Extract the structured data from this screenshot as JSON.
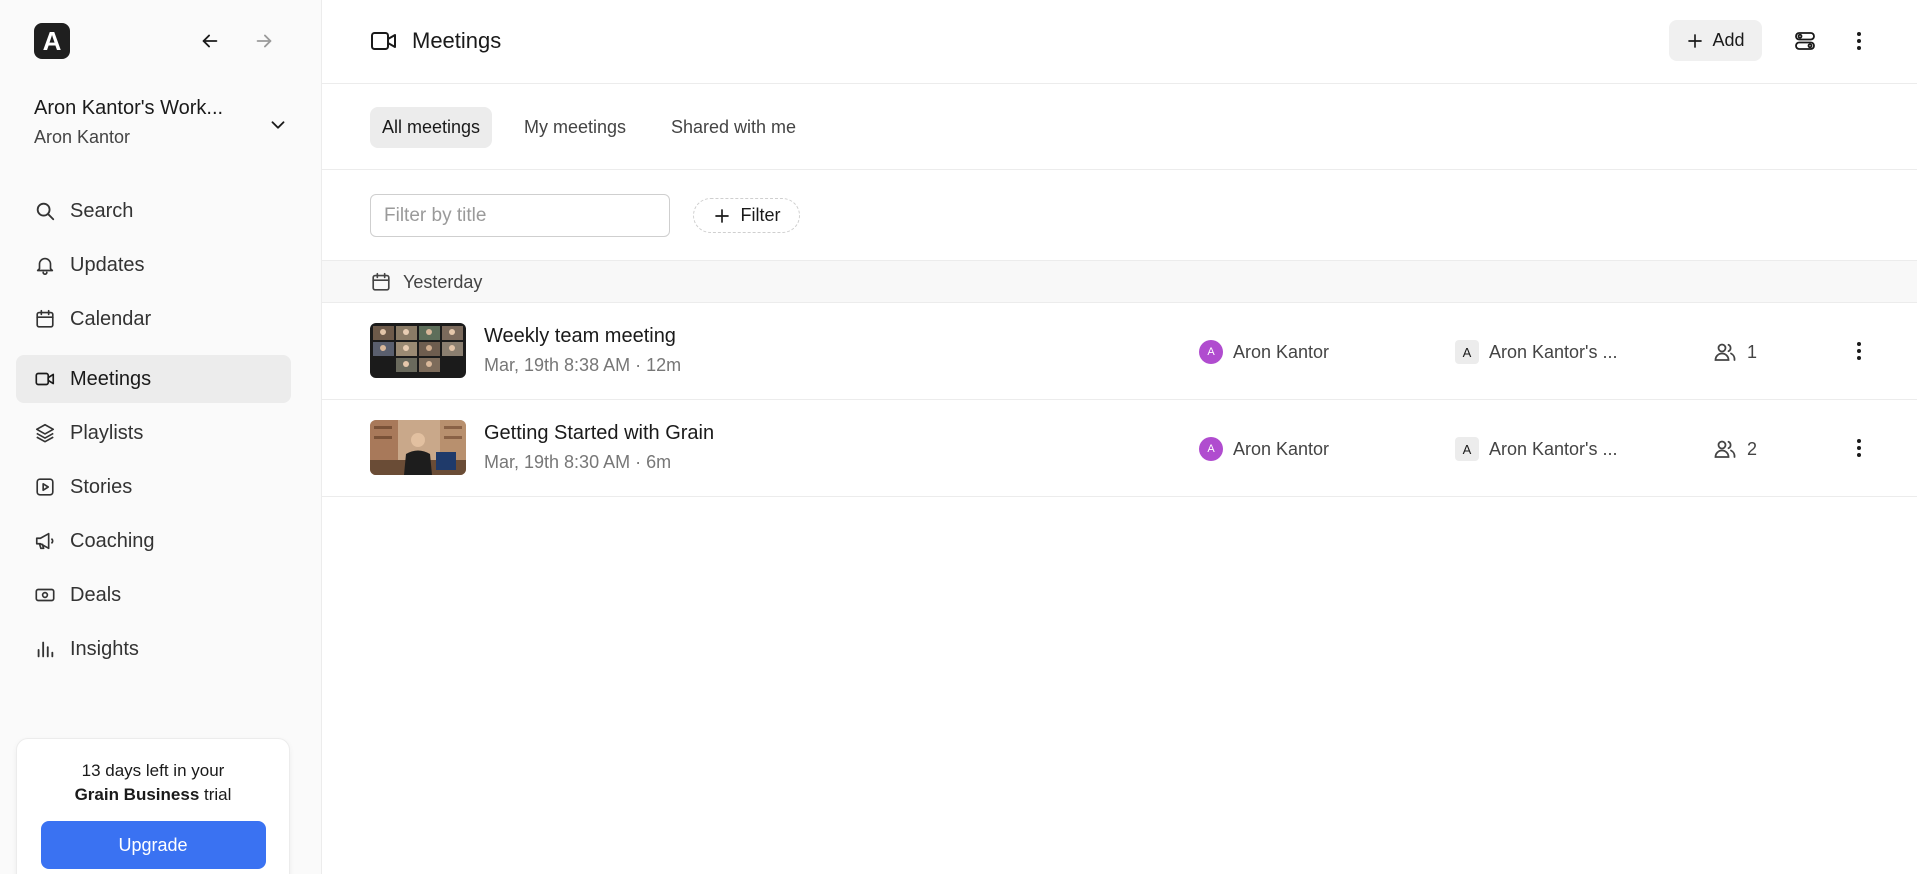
{
  "sidebar": {
    "logo_letter": "A",
    "workspace": {
      "name": "Aron Kantor's Work...",
      "user": "Aron Kantor"
    },
    "nav": [
      {
        "label": "Search",
        "icon": "search-icon"
      },
      {
        "label": "Updates",
        "icon": "bell-icon"
      },
      {
        "label": "Calendar",
        "icon": "calendar-icon"
      },
      {
        "label": "Meetings",
        "icon": "video-icon",
        "active": true
      },
      {
        "label": "Playlists",
        "icon": "layers-icon"
      },
      {
        "label": "Stories",
        "icon": "play-square-icon"
      },
      {
        "label": "Coaching",
        "icon": "megaphone-icon"
      },
      {
        "label": "Deals",
        "icon": "dollar-bill-icon"
      },
      {
        "label": "Insights",
        "icon": "bar-chart-icon"
      }
    ],
    "trial": {
      "line1": "13 days left in your",
      "plan": "Grain Business",
      "line2_suffix": "trial",
      "upgrade_label": "Upgrade"
    }
  },
  "header": {
    "title": "Meetings",
    "add_label": "Add"
  },
  "tabs": [
    {
      "label": "All meetings",
      "active": true
    },
    {
      "label": "My meetings",
      "active": false
    },
    {
      "label": "Shared with me",
      "active": false
    }
  ],
  "filters": {
    "placeholder": "Filter by title",
    "value": "",
    "filter_label": "Filter"
  },
  "group": {
    "label": "Yesterday"
  },
  "meetings": [
    {
      "title": "Weekly team meeting",
      "meta": "Mar, 19th 8:38 AM · 12m",
      "owner": "Aron Kantor",
      "owner_initial": "A",
      "workspace": "Aron Kantor's ...",
      "workspace_initial": "A",
      "participants": "1"
    },
    {
      "title": "Getting Started with Grain",
      "meta": "Mar, 19th 8:30 AM · 6m",
      "owner": "Aron Kantor",
      "owner_initial": "A",
      "workspace": "Aron Kantor's ...",
      "workspace_initial": "A",
      "participants": "2"
    }
  ],
  "colors": {
    "accent": "#3a72f2",
    "avatar": "#b04ccf",
    "active_bg": "#ececec"
  }
}
